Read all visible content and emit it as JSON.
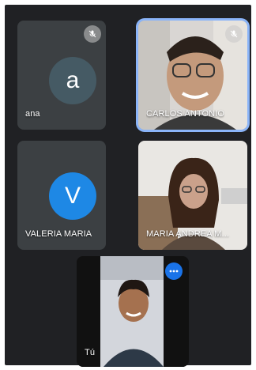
{
  "participants": [
    {
      "name": "ana",
      "initial": "a",
      "muted": true,
      "avatar_color": "#455a64",
      "type": "avatar"
    },
    {
      "name": "CARLOS ANTONIO",
      "muted": true,
      "active_speaker": true,
      "type": "video"
    },
    {
      "name": "VALERIA MARIA",
      "initial": "V",
      "muted": false,
      "avatar_color": "#1e88e5",
      "type": "avatar"
    },
    {
      "name": "MARIA ANDREA M...",
      "muted": false,
      "type": "video"
    },
    {
      "name": "Tú",
      "self": true,
      "type": "video"
    }
  ],
  "colors": {
    "background": "#202124",
    "tile": "#3c4043",
    "active_border": "#8ab4f8",
    "more_badge": "#1a73e8"
  },
  "icons": {
    "muted": "mic-off-icon",
    "more": "more-options-icon"
  }
}
